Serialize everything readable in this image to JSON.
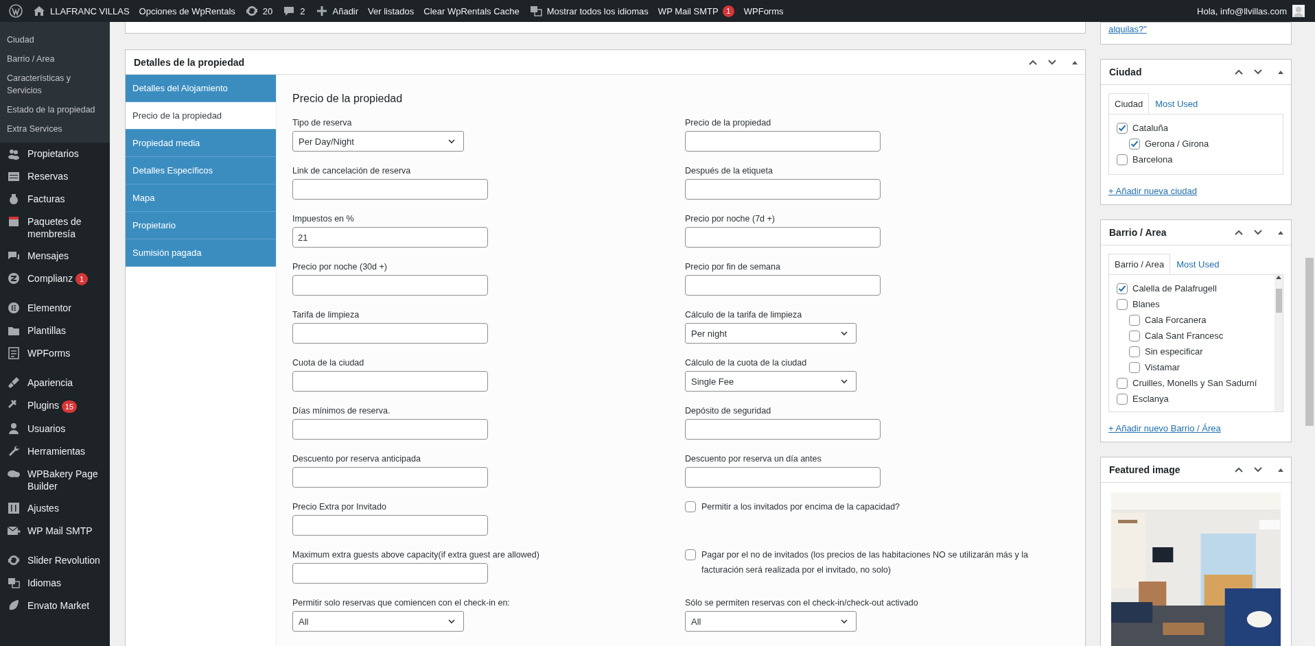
{
  "admin_bar": {
    "items": [
      {
        "kind": "logo"
      },
      {
        "kind": "home",
        "label": "LLAFRANC VILLAS"
      },
      {
        "kind": "text",
        "label": "Opciones de WpRentals"
      },
      {
        "kind": "updates",
        "label": "20"
      },
      {
        "kind": "comments",
        "label": "2"
      },
      {
        "kind": "new",
        "label": "Añadir"
      },
      {
        "kind": "text",
        "label": "Ver listados"
      },
      {
        "kind": "text",
        "label": "Clear WpRentals Cache"
      },
      {
        "kind": "languages",
        "label": "Mostrar todos los idiomas"
      },
      {
        "kind": "text",
        "label": "WP Mail SMTP",
        "badge": "1"
      },
      {
        "kind": "text",
        "label": "WPForms"
      }
    ],
    "greeting": "Hola, info@llvillas.com"
  },
  "sidebar": {
    "submenu": [
      "Ciudad",
      "Barrio / Area",
      "Características y Servicios",
      "Estado de la propiedad",
      "Extra Services"
    ],
    "menu_groups": [
      [
        {
          "label": "Propietarios"
        },
        {
          "label": "Reservas"
        },
        {
          "label": "Facturas"
        },
        {
          "label": "Paquetes de membresía"
        },
        {
          "label": "Mensajes"
        },
        {
          "label": "Complianz",
          "badge": "1"
        }
      ],
      [
        {
          "label": "Elementor"
        },
        {
          "label": "Plantillas"
        },
        {
          "label": "WPForms"
        }
      ],
      [
        {
          "label": "Apariencia"
        },
        {
          "label": "Plugins",
          "badge": "15"
        },
        {
          "label": "Usuarios"
        },
        {
          "label": "Herramientas"
        },
        {
          "label": "WPBakery Page Builder"
        },
        {
          "label": "Ajustes"
        },
        {
          "label": "WP Mail SMTP"
        }
      ],
      [
        {
          "label": "Slider Revolution"
        },
        {
          "label": "Idiomas"
        },
        {
          "label": "Envato Market"
        }
      ]
    ]
  },
  "property_box": {
    "title": "Detalles de la propiedad",
    "tabs": [
      {
        "label": "Detalles del Alojamiento",
        "selected": false
      },
      {
        "label": "Precio de la propiedad",
        "selected": true
      },
      {
        "label": "Propiedad media",
        "selected": false
      },
      {
        "label": "Detalles Específicos",
        "selected": false
      },
      {
        "label": "Mapa",
        "selected": false
      },
      {
        "label": "Propietario",
        "selected": false
      },
      {
        "label": "Sumisión pagada",
        "selected": false
      }
    ],
    "section_title": "Precio de la propiedad",
    "rows": [
      {
        "left": {
          "kind": "select",
          "label": "Tipo de reserva",
          "value": "Per Day/Night"
        },
        "right": {
          "kind": "input",
          "label": "Precio de la propiedad"
        }
      },
      {
        "left": {
          "kind": "input",
          "label": "Link de cancelación de reserva"
        },
        "right": {
          "kind": "input",
          "label": "Después de la etiqueta"
        }
      },
      {
        "left": {
          "kind": "input",
          "label": "Impuestos en %",
          "value": "21"
        },
        "right": {
          "kind": "input",
          "label": "Precio por noche (7d +)"
        }
      },
      {
        "left": {
          "kind": "input",
          "label": "Precio por noche (30d +)"
        },
        "right": {
          "kind": "input",
          "label": "Precio por fin de semana"
        }
      },
      {
        "left": {
          "kind": "input",
          "label": "Tarifa de limpieza"
        },
        "right": {
          "kind": "select",
          "label": "Cálculo de la tarifa de limpieza",
          "value": "Per night"
        }
      },
      {
        "left": {
          "kind": "input",
          "label": "Cuota de la ciudad"
        },
        "right": {
          "kind": "select",
          "label": "Cálculo de la cuota de la ciudad",
          "value": "Single Fee"
        }
      },
      {
        "left": {
          "kind": "input",
          "label": "Días mínimos de reserva."
        },
        "right": {
          "kind": "input",
          "label": "Depósito de seguridad"
        }
      },
      {
        "left": {
          "kind": "input",
          "label": "Descuento por reserva anticipada"
        },
        "right": {
          "kind": "input",
          "label": "Descuento por reserva un día antes"
        }
      },
      {
        "left": {
          "kind": "input",
          "label": "Precio Extra por Invitado"
        },
        "right": {
          "kind": "checkbox",
          "label": "Permitir a los invitados por encima de la capacidad?",
          "checked": false
        }
      },
      {
        "left": {
          "kind": "input",
          "label": "Maximum extra guests above capacity(if extra guest are allowed)"
        },
        "right": {
          "kind": "checkbox",
          "label": "Pagar por el no de invitados (los precios de las habitaciones NO se utilizarán más y la facturación será realizada por el invitado, no solo)",
          "checked": false
        }
      },
      {
        "left": {
          "kind": "select",
          "label": "Permitir solo reservas que comiencen con el check-in en:",
          "value": "All"
        },
        "right": {
          "kind": "select",
          "label": "Sólo se permiten reservas con el check-in/check-out activado",
          "value": "All"
        }
      }
    ]
  },
  "side_boxes": [
    {
      "kind": "link_stub",
      "link": "alquilas?\""
    },
    {
      "kind": "taxonomy",
      "title": "Ciudad",
      "tabs": [
        {
          "label": "Ciudad",
          "selected": true
        },
        {
          "label": "Most Used",
          "selected": false
        }
      ],
      "items": [
        {
          "label": "Cataluña",
          "checked": true,
          "children": [
            {
              "label": "Gerona / Girona",
              "checked": true
            }
          ]
        },
        {
          "label": "Barcelona",
          "checked": false
        }
      ],
      "add_link": "+ Añadir nueva ciudad"
    },
    {
      "kind": "taxonomy",
      "title": "Barrio / Area",
      "tabs": [
        {
          "label": "Barrio / Area",
          "selected": true
        },
        {
          "label": "Most Used",
          "selected": false
        }
      ],
      "items": [
        {
          "label": "Calella de Palafrugell",
          "checked": true
        },
        {
          "label": "Blanes",
          "checked": false,
          "children": [
            {
              "label": "Cala Forcanera",
              "checked": false
            },
            {
              "label": "Cala Sant Francesc",
              "checked": false
            },
            {
              "label": "Sin especificar",
              "checked": false
            },
            {
              "label": "Vistamar",
              "checked": false
            }
          ]
        },
        {
          "label": "Cruilles, Monells y San Sadurní",
          "checked": false
        },
        {
          "label": "Esclanya",
          "checked": false
        }
      ],
      "add_link": "+ Añadir nuevo Barrio / Área"
    },
    {
      "kind": "featured",
      "title": "Featured image"
    }
  ]
}
